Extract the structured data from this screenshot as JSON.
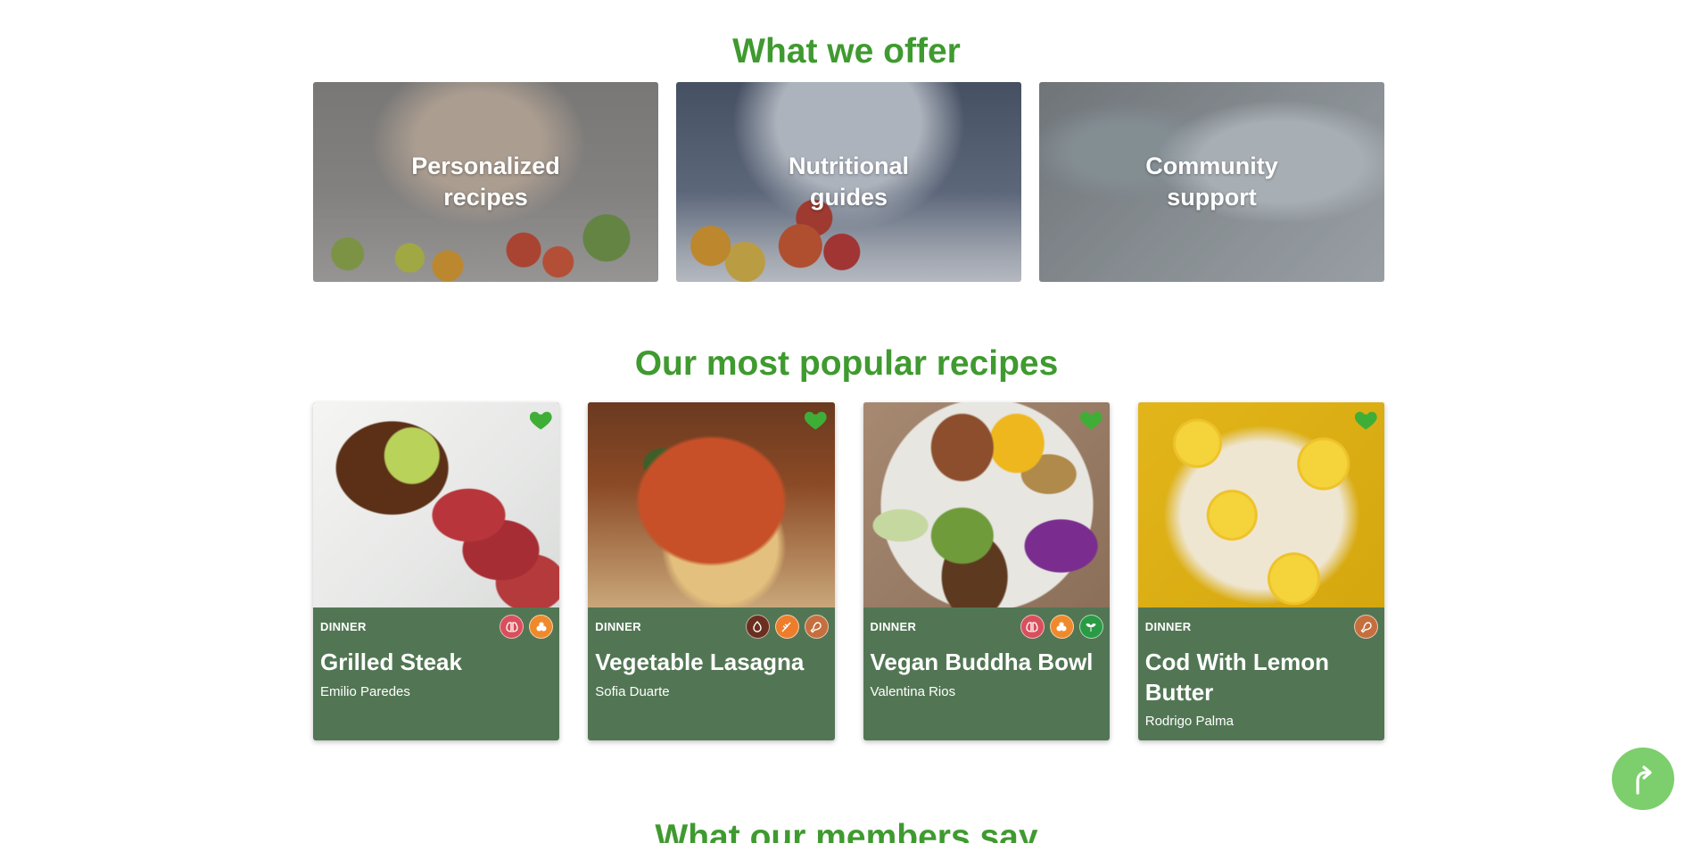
{
  "sections": {
    "offer_title": "What we offer",
    "popular_title": "Our most popular recipes",
    "members_title": "What our members say"
  },
  "offers": [
    {
      "label": "Personalized recipes"
    },
    {
      "label": "Nutritional guides"
    },
    {
      "label": "Community support"
    }
  ],
  "recipes": [
    {
      "category": "DINNER",
      "name": "Grilled Steak",
      "author": "Emilio Paredes",
      "favorite": true,
      "badges": [
        "lung-icon",
        "nuts-icon"
      ]
    },
    {
      "category": "DINNER",
      "name": "Vegetable Lasagna",
      "author": "Sofia Duarte",
      "favorite": true,
      "badges": [
        "allergen-icon",
        "wheat-icon",
        "meat-icon"
      ]
    },
    {
      "category": "DINNER",
      "name": "Vegan Buddha Bowl",
      "author": "Valentina Rios",
      "favorite": true,
      "badges": [
        "lung-icon",
        "nuts-icon",
        "vegan-icon"
      ]
    },
    {
      "category": "DINNER",
      "name": "Cod With Lemon Butter",
      "author": "Rodrigo Palma",
      "favorite": true,
      "badges": [
        "meat-icon"
      ]
    }
  ],
  "colors": {
    "accent_green": "#3f9a2f",
    "card_green": "#527654",
    "scroll_button": "#7ccf6c",
    "heart": "#3fae37"
  },
  "scroll_top_icon": "arrow-up-icon"
}
